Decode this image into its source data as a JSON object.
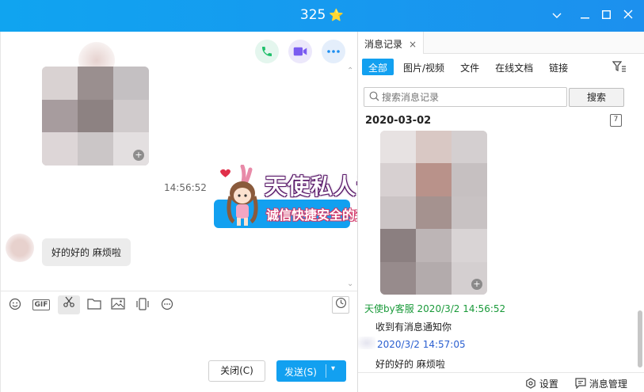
{
  "window": {
    "title": "325",
    "title_badge": "⭐",
    "controls": {
      "dropdown": "﹀",
      "minimize": "—",
      "maximize": "☐",
      "close": "✕"
    }
  },
  "chat": {
    "top_actions": [
      {
        "name": "voice-call",
        "icon": "phone-icon",
        "color": "#1fbf6a"
      },
      {
        "name": "video-call",
        "icon": "video-camera-icon",
        "color": "#7a5cf0"
      },
      {
        "name": "more",
        "icon": "more-dots-icon",
        "color": "#1c8ef0"
      }
    ],
    "messages": {
      "timestamp": "14:56:52",
      "incoming_text": "好的好的 麻烦啦"
    },
    "toolbar": {
      "emoji": "☺",
      "gif": "GIF",
      "scissors": "✂",
      "folder": "🗀",
      "image": "🖼",
      "shake": "📳",
      "more": "⋯",
      "history": "🕘"
    },
    "buttons": {
      "close_label": "关闭(C)",
      "send_label": "发送(S)",
      "send_arrow": "▾"
    }
  },
  "banner": {
    "line1": "天使私人订制",
    "line2": "诚信快捷安全的交友平台"
  },
  "history": {
    "tab_label": "消息记录",
    "tab_close": "×",
    "filters": [
      "全部",
      "图片/视频",
      "文件",
      "在线文档",
      "链接"
    ],
    "active_filter": 0,
    "search_placeholder": "搜索消息记录",
    "search_button": "搜索",
    "date": "2020-03-02",
    "calendar_day": "7",
    "entries": {
      "sender_line": "天使by客服 2020/3/2 14:56:52",
      "line1": "收到有消息通知你",
      "time2": "2020/3/2 14:57:05",
      "line2": "好的好的 麻烦啦"
    },
    "footer": {
      "settings": "设置",
      "manage": "消息管理"
    }
  }
}
